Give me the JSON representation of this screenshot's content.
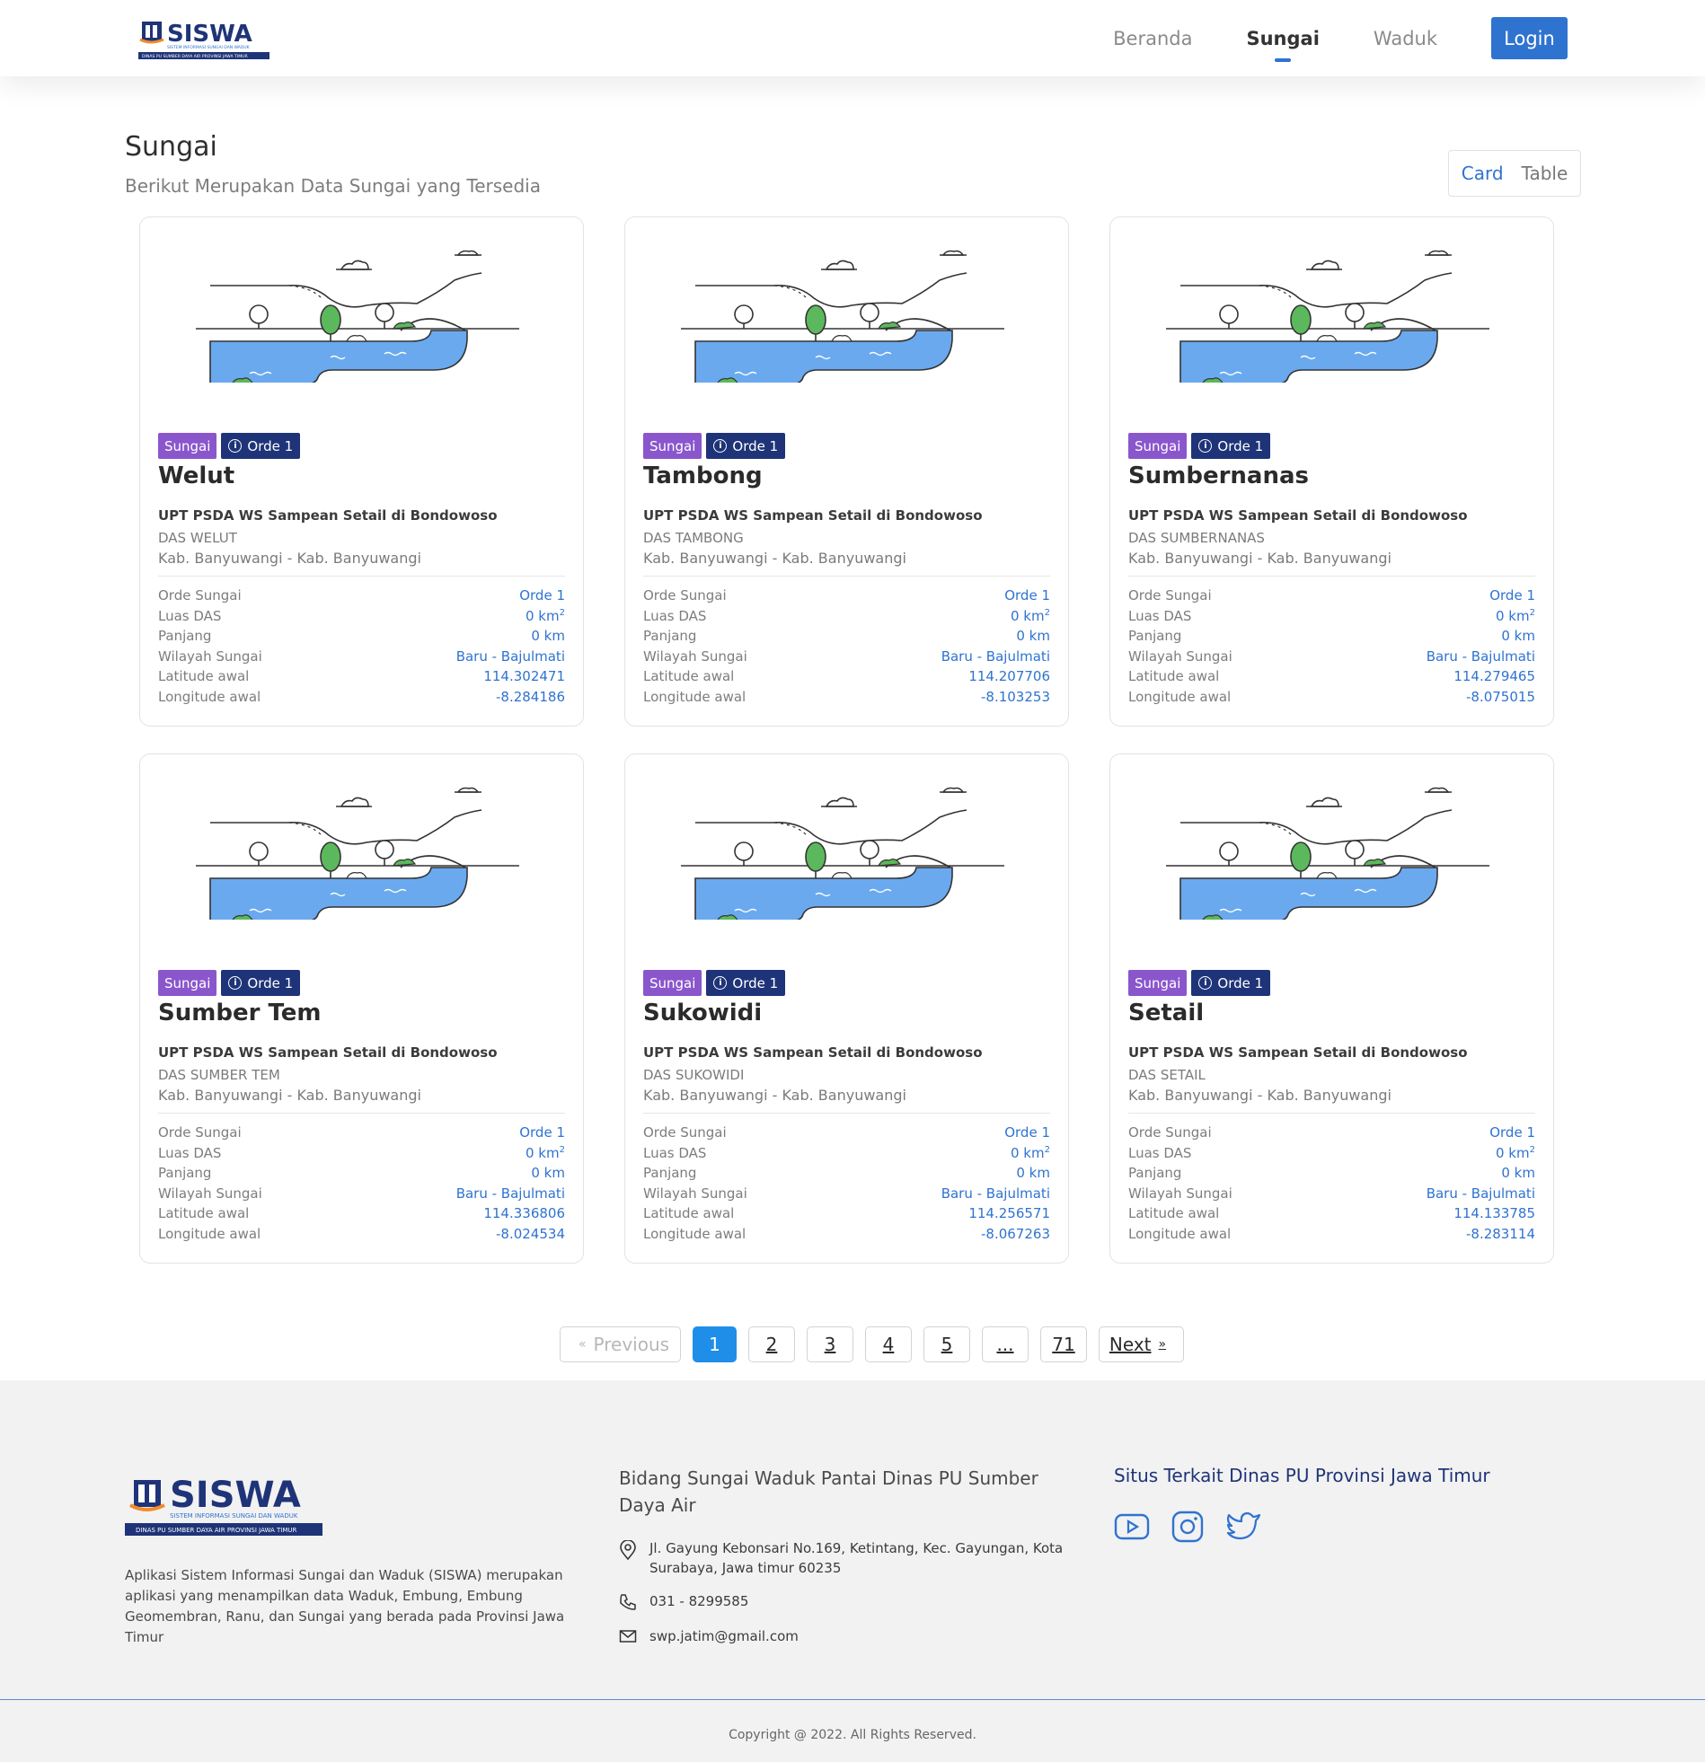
{
  "brand": {
    "name": "SISWA",
    "tagline": "SISTEM INFORMASI SUNGAI DAN WADUK",
    "org_strip": "DINAS PU SUMBER DAYA AIR PROVINSI JAWA TIMUR"
  },
  "nav": {
    "items": [
      {
        "label": "Beranda"
      },
      {
        "label": "Sungai"
      },
      {
        "label": "Waduk"
      }
    ],
    "active": "Sungai",
    "login_label": "Login"
  },
  "header": {
    "title": "Sungai",
    "subtitle": "Berikut Merupakan Data Sungai yang Tersedia",
    "toggle_card": "Card",
    "toggle_table": "Table"
  },
  "labels": {
    "badge_type": "Sungai",
    "orde_sungai": "Orde Sungai",
    "luas_das": "Luas DAS",
    "panjang": "Panjang",
    "wilayah_sungai": "Wilayah Sungai",
    "latitude_awal": "Latitude awal",
    "longitude_awal": "Longitude awal"
  },
  "rivers": [
    {
      "name": "Welut",
      "badge_orde": "Orde 1",
      "upt": "UPT PSDA WS Sampean Setail di Bondowoso",
      "das": "DAS WELUT",
      "kab": "Kab. Banyuwangi - Kab. Banyuwangi",
      "orde": "Orde 1",
      "luas": "0 km",
      "panjang": "0 km",
      "wilayah": "Baru - Bajulmati",
      "lat": "114.302471",
      "lon": "-8.284186"
    },
    {
      "name": "Tambong",
      "badge_orde": "Orde 1",
      "upt": "UPT PSDA WS Sampean Setail di Bondowoso",
      "das": "DAS TAMBONG",
      "kab": "Kab. Banyuwangi - Kab. Banyuwangi",
      "orde": "Orde 1",
      "luas": "0 km",
      "panjang": "0 km",
      "wilayah": "Baru - Bajulmati",
      "lat": "114.207706",
      "lon": "-8.103253"
    },
    {
      "name": "Sumbernanas",
      "badge_orde": "Orde 1",
      "upt": "UPT PSDA WS Sampean Setail di Bondowoso",
      "das": "DAS SUMBERNANAS",
      "kab": "Kab. Banyuwangi - Kab. Banyuwangi",
      "orde": "Orde 1",
      "luas": "0 km",
      "panjang": "0 km",
      "wilayah": "Baru - Bajulmati",
      "lat": "114.279465",
      "lon": "-8.075015"
    },
    {
      "name": "Sumber Tem",
      "badge_orde": "Orde 1",
      "upt": "UPT PSDA WS Sampean Setail di Bondowoso",
      "das": "DAS SUMBER TEM",
      "kab": "Kab. Banyuwangi - Kab. Banyuwangi",
      "orde": "Orde 1",
      "luas": "0 km",
      "panjang": "0 km",
      "wilayah": "Baru - Bajulmati",
      "lat": "114.336806",
      "lon": "-8.024534"
    },
    {
      "name": "Sukowidi",
      "badge_orde": "Orde 1",
      "upt": "UPT PSDA WS Sampean Setail di Bondowoso",
      "das": "DAS SUKOWIDI",
      "kab": "Kab. Banyuwangi - Kab. Banyuwangi",
      "orde": "Orde 1",
      "luas": "0 km",
      "panjang": "0 km",
      "wilayah": "Baru - Bajulmati",
      "lat": "114.256571",
      "lon": "-8.067263"
    },
    {
      "name": "Setail",
      "badge_orde": "Orde 1",
      "upt": "UPT PSDA WS Sampean Setail di Bondowoso",
      "das": "DAS SETAIL",
      "kab": "Kab. Banyuwangi - Kab. Banyuwangi",
      "orde": "Orde 1",
      "luas": "0 km",
      "panjang": "0 km",
      "wilayah": "Baru - Bajulmati",
      "lat": "114.133785",
      "lon": "-8.283114"
    }
  ],
  "pagination": {
    "prev_label": "Previous",
    "next_label": "Next",
    "pages": [
      "1",
      "2",
      "3",
      "4",
      "5",
      "...",
      "71"
    ],
    "active_page": "1"
  },
  "footer": {
    "about": "Aplikasi Sistem Informasi Sungai dan Waduk (SISWA) merupakan aplikasi yang menampilkan data Waduk, Embung, Embung Geomembran, Ranu, dan Sungai yang berada pada Provinsi Jawa Timur",
    "office_title": "Bidang Sungai Waduk Pantai Dinas PU Sumber Daya Air",
    "address": "Jl. Gayung Kebonsari No.169, Ketintang, Kec. Gayungan, Kota Surabaya, Jawa timur 60235",
    "phone": "031 - 8299585",
    "email": "swp.jatim@gmail.com",
    "related_title": "Situs Terkait Dinas PU Provinsi Jawa Timur",
    "socials": [
      "youtube-icon",
      "instagram-icon",
      "twitter-icon"
    ],
    "copyright": "Copyright @ 2022. All Rights Reserved."
  },
  "colors": {
    "primary": "#2f73d0",
    "badge_sungai": "#8a56cc",
    "badge_orde": "#1f3478",
    "pagination_active": "#1f8ee8",
    "footer_bg": "#f2f2f2"
  }
}
